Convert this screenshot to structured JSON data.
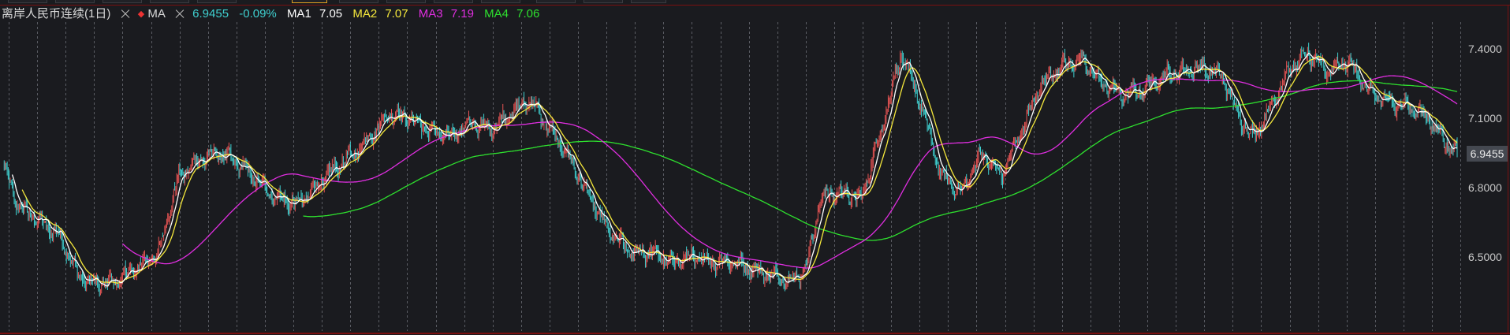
{
  "legend": {
    "title": "离岸人民币连续(1日)",
    "indicator": "MA",
    "last_price": "6.9455",
    "change_pct": "-0.09%",
    "ma1": {
      "name": "MA1",
      "value": "7.05",
      "color": "#ffffff"
    },
    "ma2": {
      "name": "MA2",
      "value": "7.07",
      "color": "#f5e83c"
    },
    "ma3": {
      "name": "MA3",
      "value": "7.19",
      "color": "#e02ee0"
    },
    "ma4": {
      "name": "MA4",
      "value": "7.06",
      "color": "#2ee02e"
    }
  },
  "colors": {
    "up": "#e85454",
    "down": "#3fd0d0",
    "last_price": "#3fd0d0",
    "change": "#3fd0d0",
    "grid": "#5a5c63",
    "axis_text": "#c8c8c8",
    "frame": "#7a1010"
  },
  "price_badge": "6.9455",
  "chart_data": {
    "type": "candlestick",
    "grid": "dashed vertical lines",
    "y_ticks": [
      "7.4000",
      "7.1000",
      "6.8000",
      "6.5000"
    ],
    "ylim": [
      6.3,
      7.55
    ],
    "num_bars": 1450,
    "close_anchors": [
      [
        0,
        6.89
      ],
      [
        15,
        6.72
      ],
      [
        35,
        6.66
      ],
      [
        55,
        6.6
      ],
      [
        75,
        6.42
      ],
      [
        95,
        6.38
      ],
      [
        115,
        6.4
      ],
      [
        135,
        6.46
      ],
      [
        155,
        6.52
      ],
      [
        175,
        6.85
      ],
      [
        195,
        6.92
      ],
      [
        215,
        6.95
      ],
      [
        235,
        6.9
      ],
      [
        255,
        6.82
      ],
      [
        275,
        6.75
      ],
      [
        295,
        6.73
      ],
      [
        315,
        6.82
      ],
      [
        335,
        6.9
      ],
      [
        350,
        6.95
      ],
      [
        365,
        7.02
      ],
      [
        385,
        7.12
      ],
      [
        405,
        7.1
      ],
      [
        425,
        7.05
      ],
      [
        445,
        7.02
      ],
      [
        465,
        7.08
      ],
      [
        485,
        7.05
      ],
      [
        505,
        7.12
      ],
      [
        525,
        7.18
      ],
      [
        545,
        7.05
      ],
      [
        565,
        6.92
      ],
      [
        585,
        6.75
      ],
      [
        605,
        6.6
      ],
      [
        625,
        6.52
      ],
      [
        645,
        6.52
      ],
      [
        665,
        6.48
      ],
      [
        685,
        6.5
      ],
      [
        705,
        6.48
      ],
      [
        725,
        6.48
      ],
      [
        745,
        6.45
      ],
      [
        765,
        6.42
      ],
      [
        785,
        6.4
      ],
      [
        800,
        6.45
      ],
      [
        815,
        6.76
      ],
      [
        835,
        6.78
      ],
      [
        855,
        6.75
      ],
      [
        875,
        7.05
      ],
      [
        895,
        7.38
      ],
      [
        915,
        7.15
      ],
      [
        935,
        6.85
      ],
      [
        955,
        6.78
      ],
      [
        975,
        6.95
      ],
      [
        995,
        6.85
      ],
      [
        1015,
        7.05
      ],
      [
        1035,
        7.25
      ],
      [
        1055,
        7.33
      ],
      [
        1075,
        7.35
      ],
      [
        1095,
        7.25
      ],
      [
        1115,
        7.2
      ],
      [
        1135,
        7.22
      ],
      [
        1155,
        7.28
      ],
      [
        1175,
        7.3
      ],
      [
        1195,
        7.32
      ],
      [
        1215,
        7.28
      ],
      [
        1230,
        7.12
      ],
      [
        1245,
        7.02
      ],
      [
        1260,
        7.12
      ],
      [
        1280,
        7.3
      ],
      [
        1300,
        7.38
      ],
      [
        1320,
        7.3
      ],
      [
        1340,
        7.35
      ],
      [
        1360,
        7.22
      ],
      [
        1380,
        7.17
      ],
      [
        1400,
        7.15
      ],
      [
        1420,
        7.1
      ],
      [
        1440,
        6.98
      ],
      [
        1449,
        6.9455
      ]
    ],
    "ma_periods": {
      "MA1": 10,
      "MA2": 20,
      "MA3": 120,
      "MA4": 300
    }
  }
}
